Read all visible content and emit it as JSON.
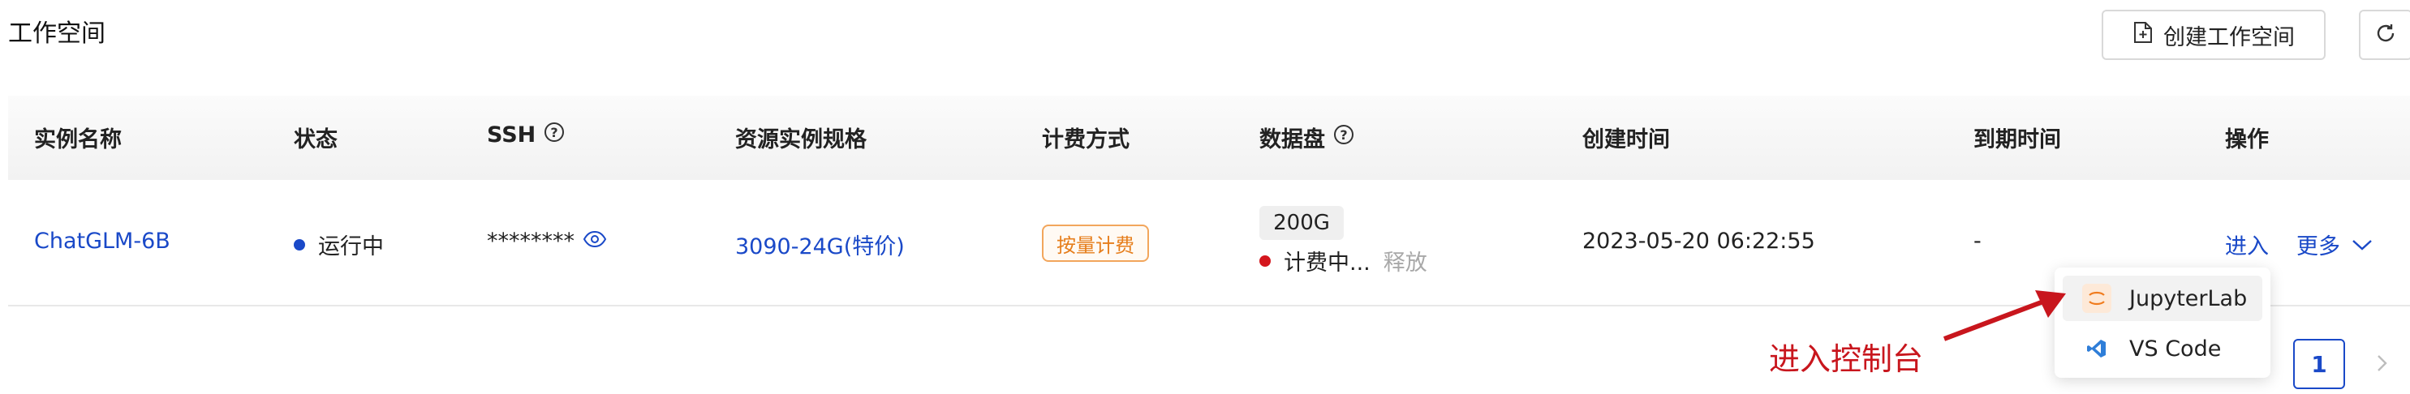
{
  "page": {
    "title": "工作空间"
  },
  "toolbar": {
    "create_label": "创建工作空间",
    "create_icon": "file-plus-icon",
    "refresh_icon": "refresh-icon"
  },
  "table": {
    "headers": {
      "name": "实例名称",
      "status": "状态",
      "ssh": "SSH",
      "spec": "资源实例规格",
      "billing": "计费方式",
      "disk": "数据盘",
      "created": "创建时间",
      "expire": "到期时间",
      "actions": "操作"
    },
    "rows": [
      {
        "name": "ChatGLM-6B",
        "status": "运行中",
        "status_color": "#1a49c8",
        "ssh": "********",
        "spec": "3090-24G(特价)",
        "billing": "按量计费",
        "disk_size": "200G",
        "disk_status": "计费中...",
        "disk_status_color": "#d4161d",
        "disk_release": "释放",
        "created": "2023-05-20 06:22:55",
        "expire": "-",
        "action_enter": "进入",
        "action_more": "更多"
      }
    ]
  },
  "dropdown": {
    "items": [
      {
        "label": "JupyterLab",
        "icon": "jupyter-icon"
      },
      {
        "label": "VS Code",
        "icon": "vscode-icon"
      }
    ]
  },
  "annotation": {
    "text": "进入控制台",
    "color": "#c8161d"
  },
  "pagination": {
    "current": "1"
  }
}
